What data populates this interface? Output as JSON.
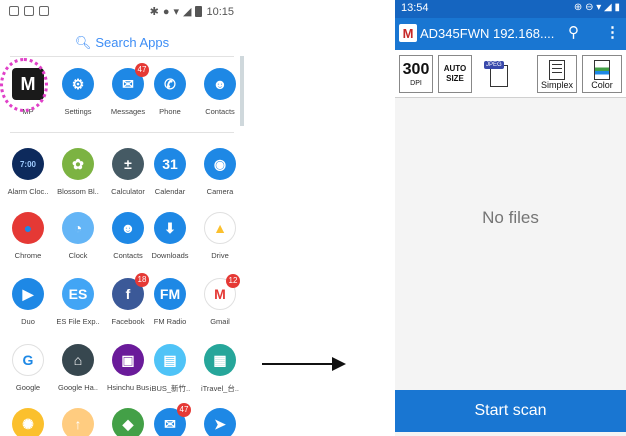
{
  "left_phone": {
    "status_time": "10:15",
    "search_label": "Search Apps",
    "apps": [
      {
        "label": "MP",
        "glyph": "M",
        "bg": "#1a1a1a",
        "fg": "#ffffff",
        "icon": "mp-app-icon"
      },
      {
        "label": "Settings",
        "glyph": "⚙",
        "bg": "#1e88e5",
        "fg": "#ffffff",
        "icon": "gear-icon"
      },
      {
        "label": "Messages",
        "glyph": "✉",
        "bg": "#1e88e5",
        "fg": "#ffffff",
        "icon": "messages-icon",
        "badge": "47"
      },
      {
        "label": "Phone",
        "glyph": "✆",
        "bg": "#1e88e5",
        "fg": "#ffffff",
        "icon": "phone-icon"
      },
      {
        "label": "Contacts",
        "glyph": "☻",
        "bg": "#1e88e5",
        "fg": "#ffffff",
        "icon": "contacts-icon"
      },
      {
        "label": "Alarm Cloc..",
        "glyph": "7:00",
        "bg": "#0d2a5c",
        "fg": "#9ecbff",
        "icon": "alarm-clock-icon"
      },
      {
        "label": "Blossom Bl..",
        "glyph": "✿",
        "bg": "#7cb342",
        "fg": "#ffffff",
        "icon": "blossom-icon"
      },
      {
        "label": "Calculator",
        "glyph": "±",
        "bg": "#455a64",
        "fg": "#ffffff",
        "icon": "calculator-icon"
      },
      {
        "label": "Calendar",
        "glyph": "31",
        "bg": "#1e88e5",
        "fg": "#ffffff",
        "icon": "calendar-icon"
      },
      {
        "label": "Camera",
        "glyph": "◉",
        "bg": "#1e88e5",
        "fg": "#ffffff",
        "icon": "camera-icon"
      },
      {
        "label": "Chrome",
        "glyph": "●",
        "bg": "#e53935",
        "fg": "#1e88e5",
        "icon": "chrome-icon"
      },
      {
        "label": "Clock",
        "glyph": "◔",
        "bg": "#64b5f6",
        "fg": "#ffffff",
        "icon": "clock-icon"
      },
      {
        "label": "Contacts",
        "glyph": "☻",
        "bg": "#1e88e5",
        "fg": "#ffffff",
        "icon": "contacts-icon"
      },
      {
        "label": "Downloads",
        "glyph": "⬇",
        "bg": "#1e88e5",
        "fg": "#ffffff",
        "icon": "download-icon"
      },
      {
        "label": "Drive",
        "glyph": "▲",
        "bg": "#ffffff",
        "fg": "#fbc02d",
        "icon": "drive-icon"
      },
      {
        "label": "Duo",
        "glyph": "▶",
        "bg": "#1e88e5",
        "fg": "#ffffff",
        "icon": "duo-icon"
      },
      {
        "label": "ES File Exp..",
        "glyph": "ES",
        "bg": "#42a5f5",
        "fg": "#ffffff",
        "icon": "folder-icon"
      },
      {
        "label": "Facebook",
        "glyph": "f",
        "bg": "#3b5998",
        "fg": "#ffffff",
        "icon": "facebook-icon",
        "badge": "18"
      },
      {
        "label": "FM Radio",
        "glyph": "FM",
        "bg": "#1e88e5",
        "fg": "#ffffff",
        "icon": "radio-icon"
      },
      {
        "label": "Gmail",
        "glyph": "M",
        "bg": "#ffffff",
        "fg": "#e53935",
        "icon": "gmail-icon",
        "badge": "12"
      },
      {
        "label": "Google",
        "glyph": "G",
        "bg": "#ffffff",
        "fg": "#1e88e5",
        "icon": "google-icon"
      },
      {
        "label": "Google Ha..",
        "glyph": "⌂",
        "bg": "#37474f",
        "fg": "#ffffff",
        "icon": "home-icon"
      },
      {
        "label": "Hsinchu Bus",
        "glyph": "▣",
        "bg": "#6a1b9a",
        "fg": "#ffffff",
        "icon": "bus-icon"
      },
      {
        "label": "iBUS_新竹..",
        "glyph": "▤",
        "bg": "#4fc3f7",
        "fg": "#ffffff",
        "icon": "ibus-icon"
      },
      {
        "label": "iTravel_台..",
        "glyph": "▦",
        "bg": "#26a69a",
        "fg": "#ffffff",
        "icon": "travel-icon"
      },
      {
        "label": "",
        "glyph": "✺",
        "bg": "#fbc02d",
        "fg": "#ffffff",
        "icon": "bulb-icon"
      },
      {
        "label": "",
        "glyph": "↑",
        "bg": "#ffcc80",
        "fg": "#ffffff",
        "icon": "upload-icon"
      },
      {
        "label": "",
        "glyph": "◆",
        "bg": "#43a047",
        "fg": "#ffffff",
        "icon": "maps-icon"
      },
      {
        "label": "",
        "glyph": "✉",
        "bg": "#1e88e5",
        "fg": "#ffffff",
        "icon": "messages-icon",
        "badge": "47"
      },
      {
        "label": "",
        "glyph": "➤",
        "bg": "#1e88e5",
        "fg": "#ffffff",
        "icon": "messenger-icon"
      }
    ]
  },
  "right_phone": {
    "status_time": "13:54",
    "logo": "M",
    "title": "AD345FWN 192.168....",
    "toolbar": {
      "dpi_value": "300",
      "dpi_unit": "DPI",
      "auto_size_line1": "AUTO",
      "auto_size_line2": "SIZE",
      "jpeg_label": "JPEG",
      "simplex_label": "Simplex",
      "color_label": "Color"
    },
    "empty_message": "No files",
    "start_button": "Start scan"
  },
  "colors": {
    "accent": "#1976d2",
    "search_text": "#3d8df5",
    "highlight_ring": "#e040c8"
  }
}
